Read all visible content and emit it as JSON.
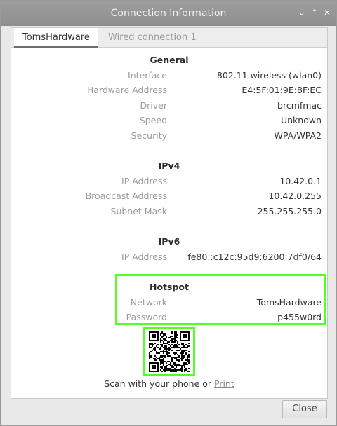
{
  "window": {
    "title": "Connection Information"
  },
  "tabs": [
    {
      "label": "TomsHardware",
      "active": true
    },
    {
      "label": "Wired connection 1",
      "active": false
    }
  ],
  "general": {
    "title": "General",
    "rows": [
      {
        "label": "Interface",
        "value": "802.11 wireless (wlan0)"
      },
      {
        "label": "Hardware Address",
        "value": "E4:5F:01:9E:8F:EC"
      },
      {
        "label": "Driver",
        "value": "brcmfmac"
      },
      {
        "label": "Speed",
        "value": "Unknown"
      },
      {
        "label": "Security",
        "value": "WPA/WPA2"
      }
    ]
  },
  "ipv4": {
    "title": "IPv4",
    "rows": [
      {
        "label": "IP Address",
        "value": "10.42.0.1"
      },
      {
        "label": "Broadcast Address",
        "value": "10.42.0.255"
      },
      {
        "label": "Subnet Mask",
        "value": "255.255.255.0"
      }
    ]
  },
  "ipv6": {
    "title": "IPv6",
    "rows": [
      {
        "label": "IP Address",
        "value": "fe80::c12c:95d9:6200:7df0/64"
      }
    ]
  },
  "hotspot": {
    "title": "Hotspot",
    "rows": [
      {
        "label": "Network",
        "value": "TomsHardware"
      },
      {
        "label": "Password",
        "value": "p455w0rd"
      }
    ]
  },
  "scan": {
    "text": "Scan with your phone or",
    "link": "Print"
  },
  "buttons": {
    "close": "Close"
  },
  "colors": {
    "highlight": "#54ff26",
    "titlebar": "#959595"
  }
}
